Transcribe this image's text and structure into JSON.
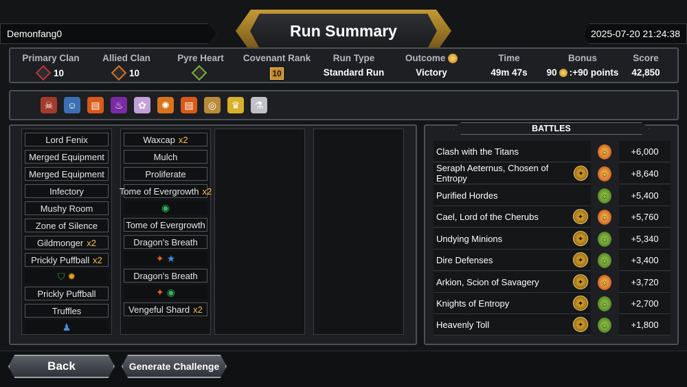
{
  "header": {
    "player_name": "Demonfang0",
    "title": "Run Summary",
    "datetime": "2025-07-20 21:24:38"
  },
  "stats": {
    "primary_clan": {
      "label": "Primary Clan",
      "value": "10",
      "icon": "clan-emblem-red"
    },
    "allied_clan": {
      "label": "Allied Clan",
      "value": "10",
      "icon": "clan-emblem-orange"
    },
    "pyre_heart": {
      "label": "Pyre Heart",
      "icon": "pyre-heart-green"
    },
    "covenant_rank": {
      "label": "Covenant Rank",
      "value": "10"
    },
    "run_type": {
      "label": "Run Type",
      "value": "Standard Run"
    },
    "outcome": {
      "label": "Outcome",
      "value": "Victory",
      "icon": "coin-swirl-icon"
    },
    "time": {
      "label": "Time",
      "value": "49m 47s"
    },
    "bonus": {
      "label": "Bonus",
      "value_prefix": "90",
      "value_suffix": ":+90 points"
    },
    "score": {
      "label": "Score",
      "value": "42,850"
    }
  },
  "relics": [
    {
      "icon": "demon-mask-icon",
      "color": "#a33b2a"
    },
    {
      "icon": "cleric-icon",
      "color": "#3b6fb3"
    },
    {
      "icon": "scroll-icon",
      "color": "#d85a18"
    },
    {
      "icon": "cauldron-icon",
      "color": "#7a2aa3"
    },
    {
      "icon": "skull-bouquet-icon",
      "color": "#c4a0d8"
    },
    {
      "icon": "octopus-icon",
      "color": "#d8741c"
    },
    {
      "icon": "scroll-icon",
      "color": "#d85a18"
    },
    {
      "icon": "amulet-icon",
      "color": "#b98a3a"
    },
    {
      "icon": "crown-icon",
      "color": "#d8b02a"
    },
    {
      "icon": "potion-icon",
      "color": "#c0c0c8"
    }
  ],
  "deck": {
    "col1": [
      {
        "name": "Lord Fenix"
      },
      {
        "name": "Merged Equipment"
      },
      {
        "name": "Merged Equipment"
      },
      {
        "name": "Infectory"
      },
      {
        "name": "Mushy Room"
      },
      {
        "name": "Zone of Silence"
      },
      {
        "name": "Gildmonger",
        "mult": "x2"
      },
      {
        "name": "Prickly Puffball",
        "mult": "x2",
        "chips": [
          "shield-green-icon",
          "starburst-gold-icon"
        ]
      },
      {
        "name": "Prickly Puffball"
      },
      {
        "name": "Truffles",
        "chips": [
          "figure-blue-icon"
        ]
      }
    ],
    "col2": [
      {
        "name": "Waxcap",
        "mult": "x2"
      },
      {
        "name": "Mulch"
      },
      {
        "name": "Proliferate"
      },
      {
        "name": "Tome of Evergrowth",
        "mult": "x2",
        "chips": [
          "eye-green-icon"
        ]
      },
      {
        "name": "Tome of Evergrowth"
      },
      {
        "name": "Dragon's Breath",
        "chips": [
          "flame-orange-icon",
          "star-blue-icon"
        ]
      },
      {
        "name": "Dragon's Breath",
        "chips": [
          "flame-orange-icon",
          "eye-green-icon"
        ]
      },
      {
        "name": "Vengeful Shard",
        "mult": "x2"
      }
    ]
  },
  "battles": {
    "title": "BATTLES",
    "rows": [
      {
        "name": "Clash with the Titans",
        "score": "+6,000",
        "boss": "titan-gold-red",
        "has_icon": false
      },
      {
        "name": "Seraph Aeternus, Chosen of Entropy",
        "score": "+8,640",
        "boss": "titan-gold-red",
        "has_icon": true
      },
      {
        "name": "Purified Hordes",
        "score": "+5,400",
        "boss": "titan-green",
        "has_icon": false
      },
      {
        "name": "Cael, Lord of the Cherubs",
        "score": "+5,760",
        "boss": "titan-gold-red",
        "has_icon": true
      },
      {
        "name": "Undying Minions",
        "score": "+5,340",
        "boss": "titan-green",
        "has_icon": true
      },
      {
        "name": "Dire Defenses",
        "score": "+3,400",
        "boss": "titan-green",
        "has_icon": true
      },
      {
        "name": "Arkion, Scion of Savagery",
        "score": "+3,720",
        "boss": "titan-gold-red",
        "has_icon": true
      },
      {
        "name": "Knights of Entropy",
        "score": "+2,700",
        "boss": "titan-green",
        "has_icon": true
      },
      {
        "name": "Heavenly Toll",
        "score": "+1,800",
        "boss": "titan-green",
        "has_icon": true
      }
    ]
  },
  "buttons": {
    "back": "Back",
    "generate_challenge": "Generate Challenge"
  }
}
